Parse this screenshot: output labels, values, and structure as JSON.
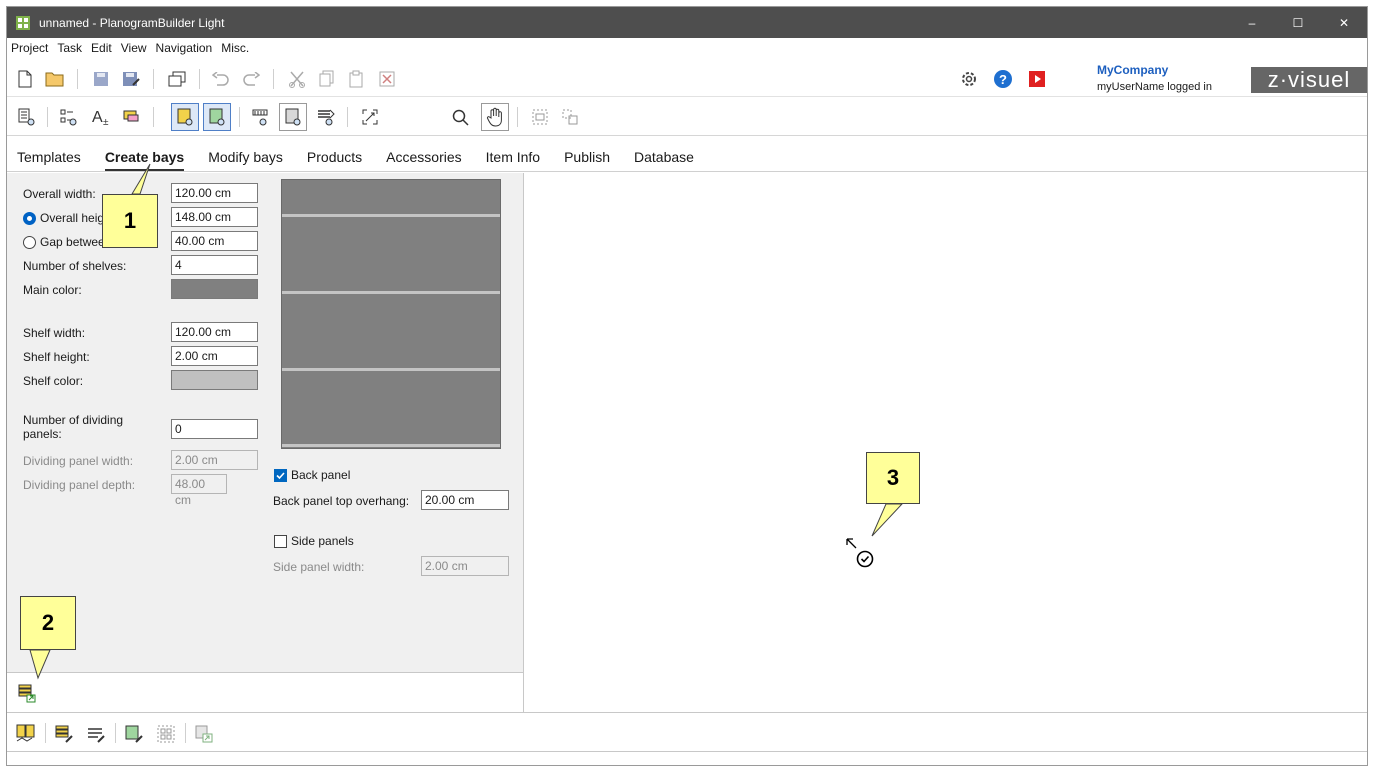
{
  "window": {
    "title": "unnamed - PlanogramBuilder Light",
    "controls": {
      "minimize": "–",
      "maximize": "☐",
      "close": "✕"
    }
  },
  "menu": [
    "Project",
    "Task",
    "Edit",
    "View",
    "Navigation",
    "Misc."
  ],
  "toolbar1": {
    "icons": [
      "new-document-icon",
      "open-folder-icon",
      "save-icon",
      "save-as-icon",
      "copy-bays-icon",
      "undo-icon",
      "redo-icon",
      "cut-icon",
      "copy-icon",
      "paste-icon",
      "delete-icon",
      "settings-icon",
      "help-icon",
      "video-icon"
    ]
  },
  "company": {
    "name": "MyCompany",
    "user": "myUserName logged in",
    "logo": "z·visuel"
  },
  "tabs": [
    "Templates",
    "Create bays",
    "Modify bays",
    "Products",
    "Accessories",
    "Item Info",
    "Publish",
    "Database"
  ],
  "active_tab": "Create bays",
  "form": {
    "overall_width_label": "Overall width:",
    "overall_width": "120.00 cm",
    "overall_height_label": "Overall heig",
    "overall_height": "148.00 cm",
    "gap_label": "Gap betwee",
    "gap": "40.00 cm",
    "shelves_label": "Number of shelves:",
    "shelves": "4",
    "main_color_label": "Main color:",
    "shelf_width_label": "Shelf width:",
    "shelf_width": "120.00 cm",
    "shelf_height_label": "Shelf height:",
    "shelf_height": "2.00 cm",
    "shelf_color_label": "Shelf color:",
    "dividing_label": "Number of dividing panels:",
    "dividing": "0",
    "dividing_width_label": "Dividing panel width:",
    "dividing_width": "2.00 cm",
    "dividing_depth_label": "Dividing panel depth:",
    "dividing_depth": "48.00 cm",
    "back_panel_label": "Back panel",
    "back_overhang_label": "Back panel top overhang:",
    "back_overhang": "20.00 cm",
    "side_panels_label": "Side panels",
    "side_width_label": "Side panel width:",
    "side_width": "2.00 cm"
  },
  "colors": {
    "main": "#808080",
    "shelf": "#c0c0c0",
    "accent": "#0067c0",
    "callout": "#ffff99"
  },
  "callouts": [
    "1",
    "2",
    "3"
  ]
}
